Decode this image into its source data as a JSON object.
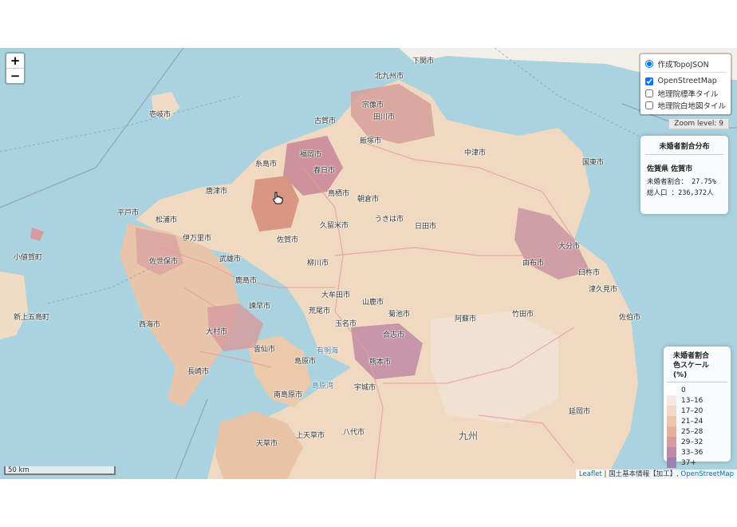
{
  "zoom": {
    "in": "+",
    "out": "−"
  },
  "layers": {
    "overlay": "作成TopoJSON",
    "base": [
      {
        "label": "OpenStreetMap",
        "checked": true
      },
      {
        "label": "地理院標準タイル",
        "checked": false
      },
      {
        "label": "地理院白地図タイル",
        "checked": false
      }
    ]
  },
  "zoom_level": "Zoom level: 9",
  "info": {
    "title": "未婚者割合分布",
    "name": "佐賀県 佐賀市",
    "rate": "未婚者割合：  27.75%",
    "pop": "総人口    ：236,372人"
  },
  "legend": {
    "title1": "未婚者割合",
    "title2": "色スケール(%)",
    "items": [
      {
        "label": "0",
        "color": "#ffffff"
      },
      {
        "label": "13–16",
        "color": "#f6e8e2"
      },
      {
        "label": "17–20",
        "color": "#f1d8c9"
      },
      {
        "label": "21–24",
        "color": "#ebc6ab"
      },
      {
        "label": "25–28",
        "color": "#e6b09a"
      },
      {
        "label": "29–32",
        "color": "#d79a9f"
      },
      {
        "label": "33–36",
        "color": "#bf8aa7"
      },
      {
        "label": "37+",
        "color": "#9b83ad"
      }
    ]
  },
  "scale": "50 km",
  "attribution": {
    "leaflet": "Leaflet",
    "sep1": " | 国土基本情報【加工】, ",
    "osm": "OpenStreetMap"
  },
  "places": {
    "shimonoseki": "下関市",
    "kitakyushu": "北九州市",
    "iki": "壱岐市",
    "munakata": "宗像市",
    "koga": "古賀市",
    "fukuoka": "福岡市",
    "iizuka": "飯塚市",
    "tagawa": "田川市",
    "nakatsu": "中津市",
    "kunisaki": "国東市",
    "itoshima": "糸島市",
    "kasuga": "春日市",
    "karatsu": "唐津市",
    "hirado": "平戸市",
    "matsuura": "松浦市",
    "tosu": "鳥栖市",
    "asakura": "朝倉市",
    "ukiha": "うきは市",
    "kurume": "久留米市",
    "imari": "伊万里市",
    "saga": "佐賀市",
    "hita": "日田市",
    "sasebo": "佐世保市",
    "takeo": "武雄市",
    "kashima": "鹿島市",
    "yanagawa": "柳川市",
    "oita": "大分市",
    "yufu": "由布市",
    "usuki": "臼杵市",
    "tsukumi": "津久見市",
    "isahaya": "諫早市",
    "omuta": "大牟田市",
    "yamaga": "山鹿市",
    "kikuchi": "菊池市",
    "aso": "阿蘇市",
    "taketa": "竹田市",
    "saiki": "佐伯市",
    "saikai": "西海市",
    "omura": "大村市",
    "arao": "荒尾市",
    "tamana": "玉名市",
    "koshi": "合志市",
    "nagasaki": "長崎市",
    "unzen": "雲仙市",
    "shimabara": "島原市",
    "kumamoto": "熊本市",
    "minamishimabara": "南島原市",
    "uki": "宇城市",
    "nobeoka": "延岡市",
    "amakusa": "天草市",
    "kamiamakusa": "上天草市",
    "yatsushiro": "八代市",
    "kyushu": "九州",
    "ojika": "小値賀町",
    "shinkamigoto": "新上五島町",
    "ariake": "有明海",
    "shimabara_bay": "島原湾"
  }
}
